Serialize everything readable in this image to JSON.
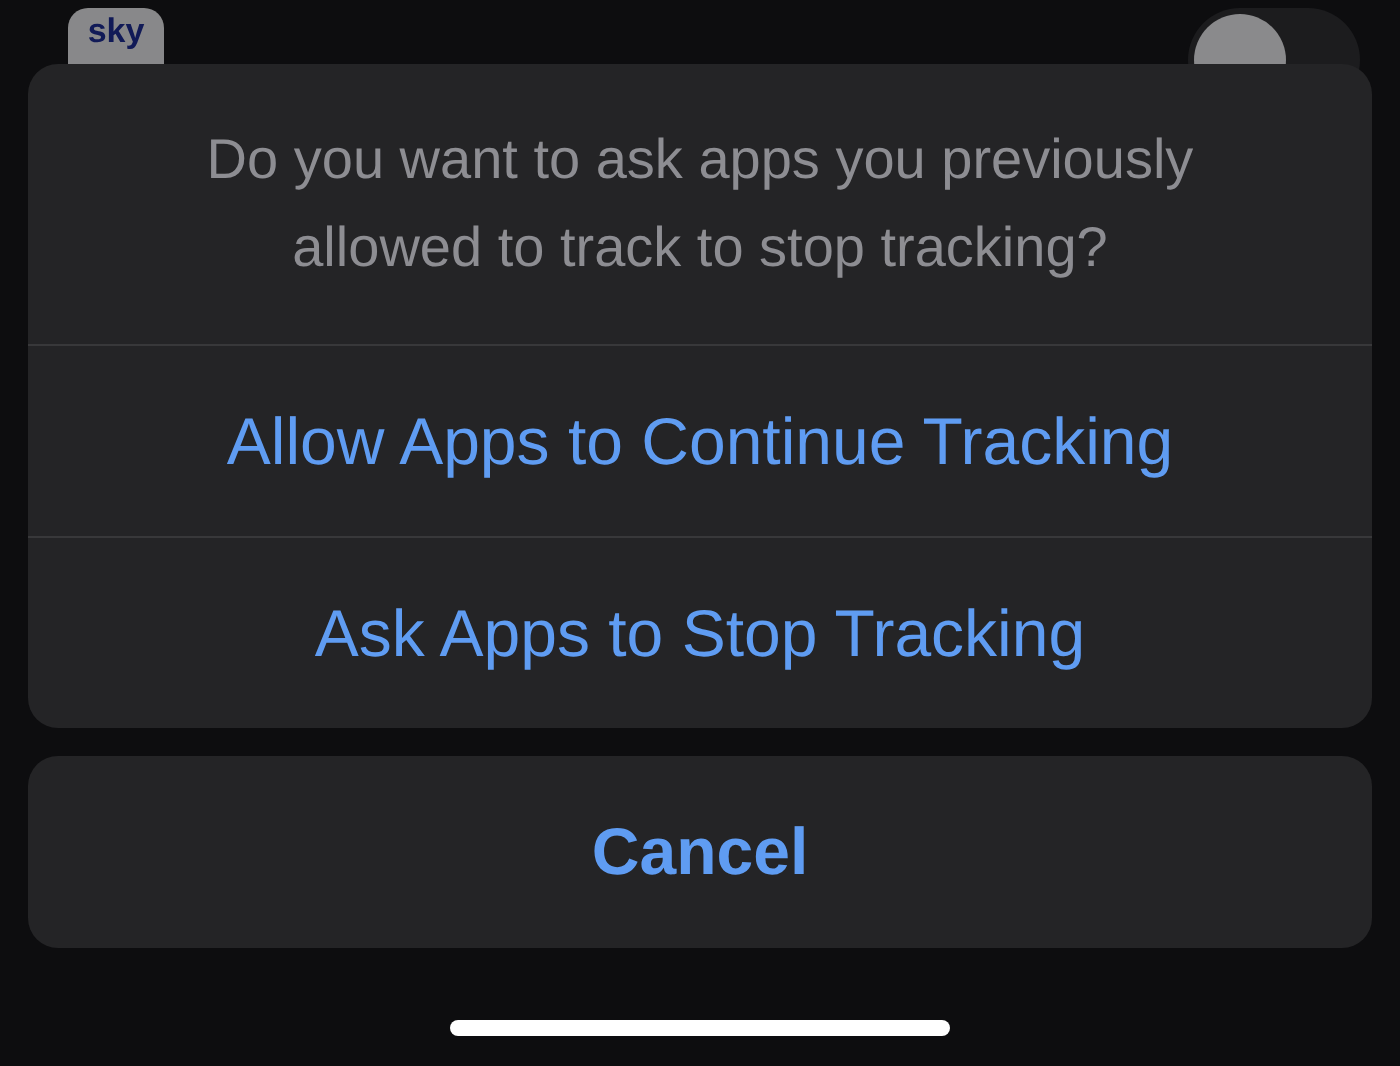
{
  "background_row": {
    "icon_text": "sky",
    "toggle": {
      "on": false
    }
  },
  "action_sheet": {
    "message": "Do you want to ask apps you previously allowed to track to stop tracking?",
    "actions": [
      {
        "label": "Allow Apps to Continue Tracking"
      },
      {
        "label": "Ask Apps to Stop Tracking"
      }
    ],
    "cancel": {
      "label": "Cancel"
    }
  }
}
